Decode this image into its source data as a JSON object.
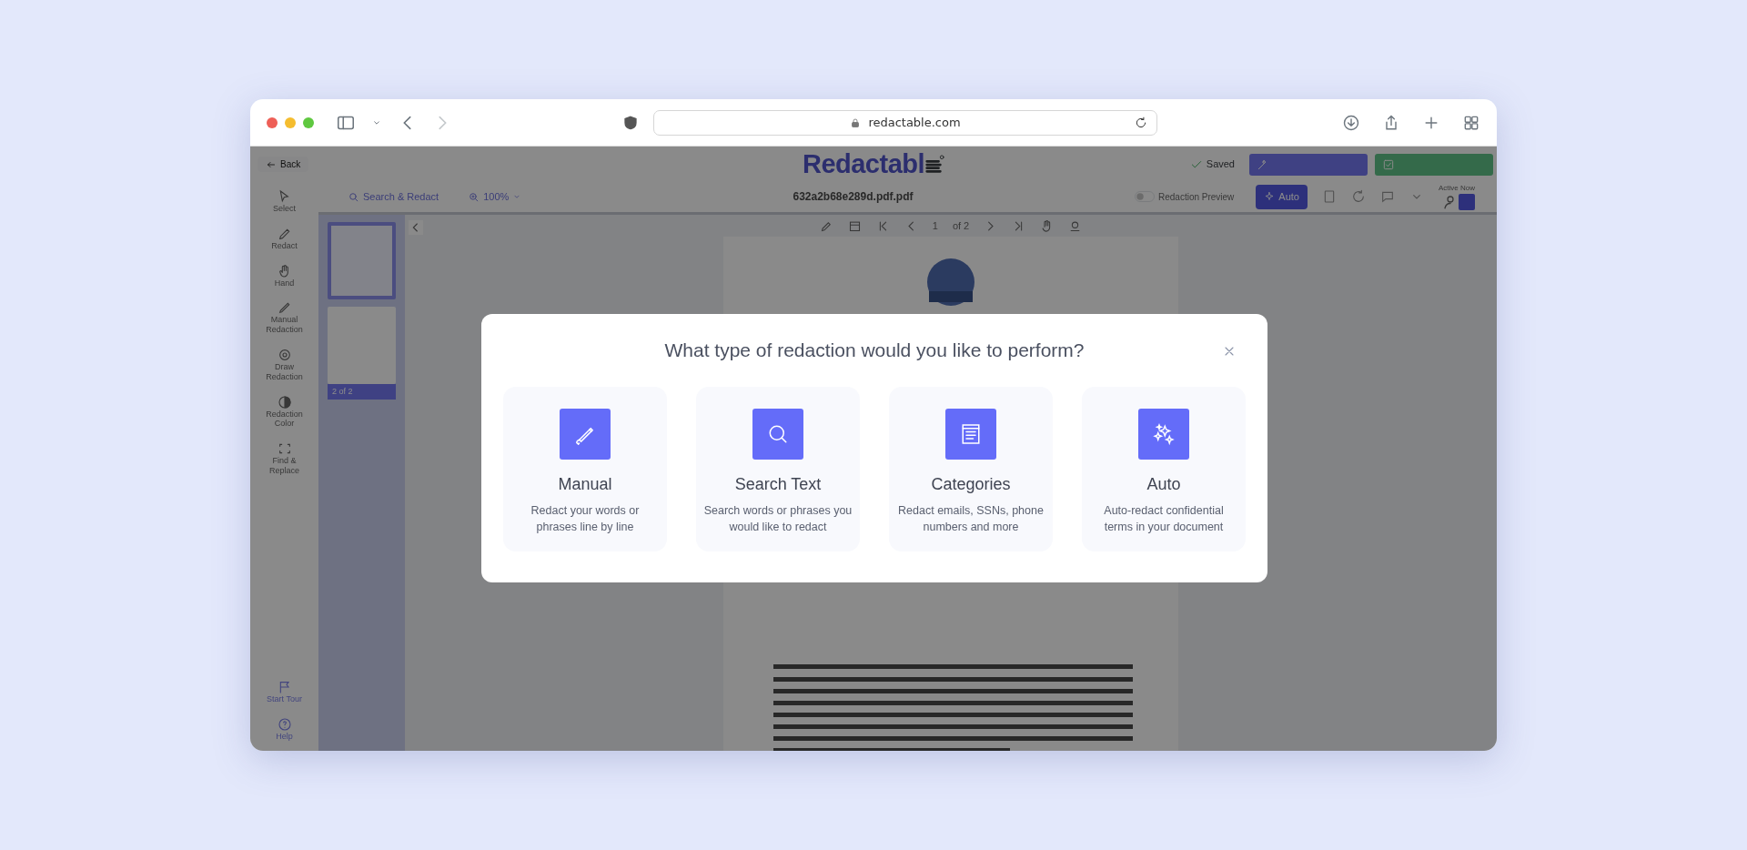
{
  "browser": {
    "url": "redactable.com"
  },
  "app": {
    "back": "Back",
    "logo": "Redactabl",
    "status": "Saved",
    "toolbar": {
      "search": "Search & Redact",
      "zoom": "100%",
      "filename": "632a2b68e289d.pdf.pdf",
      "preview_label": "Redaction Preview",
      "preview_on": false,
      "auto_button": "Auto",
      "active_label": "Active Now"
    },
    "sidebar": [
      {
        "kind": "select",
        "label": "Select"
      },
      {
        "kind": "redact",
        "label": "Redact"
      },
      {
        "kind": "hand",
        "label": "Hand"
      },
      {
        "kind": "manual",
        "label": "Manual Redaction"
      },
      {
        "kind": "draw",
        "label": "Draw Redaction"
      },
      {
        "kind": "color",
        "label": "Redaction Color"
      },
      {
        "kind": "replace",
        "label": "Find & Replace"
      }
    ],
    "sidebar_bottom": [
      {
        "kind": "tour",
        "label": "Start Tour"
      },
      {
        "kind": "help",
        "label": "Help"
      }
    ],
    "thumbnails": [
      {
        "selected": true
      },
      {
        "selected": false,
        "badge": "2 of 2"
      }
    ],
    "pager": {
      "page": "1",
      "total": "of 2"
    }
  },
  "modal": {
    "title": "What type of redaction would you like to perform?",
    "options": [
      {
        "kind": "manual",
        "title": "Manual",
        "description": "Redact your words or phrases line by line"
      },
      {
        "kind": "search",
        "title": "Search Text",
        "description": "Search words or phrases you would like to redact"
      },
      {
        "kind": "categories",
        "title": "Categories",
        "description": "Redact emails, SSNs, phone numbers and more"
      },
      {
        "kind": "auto",
        "title": "Auto",
        "description": "Auto-redact confidential terms in your document"
      }
    ]
  }
}
